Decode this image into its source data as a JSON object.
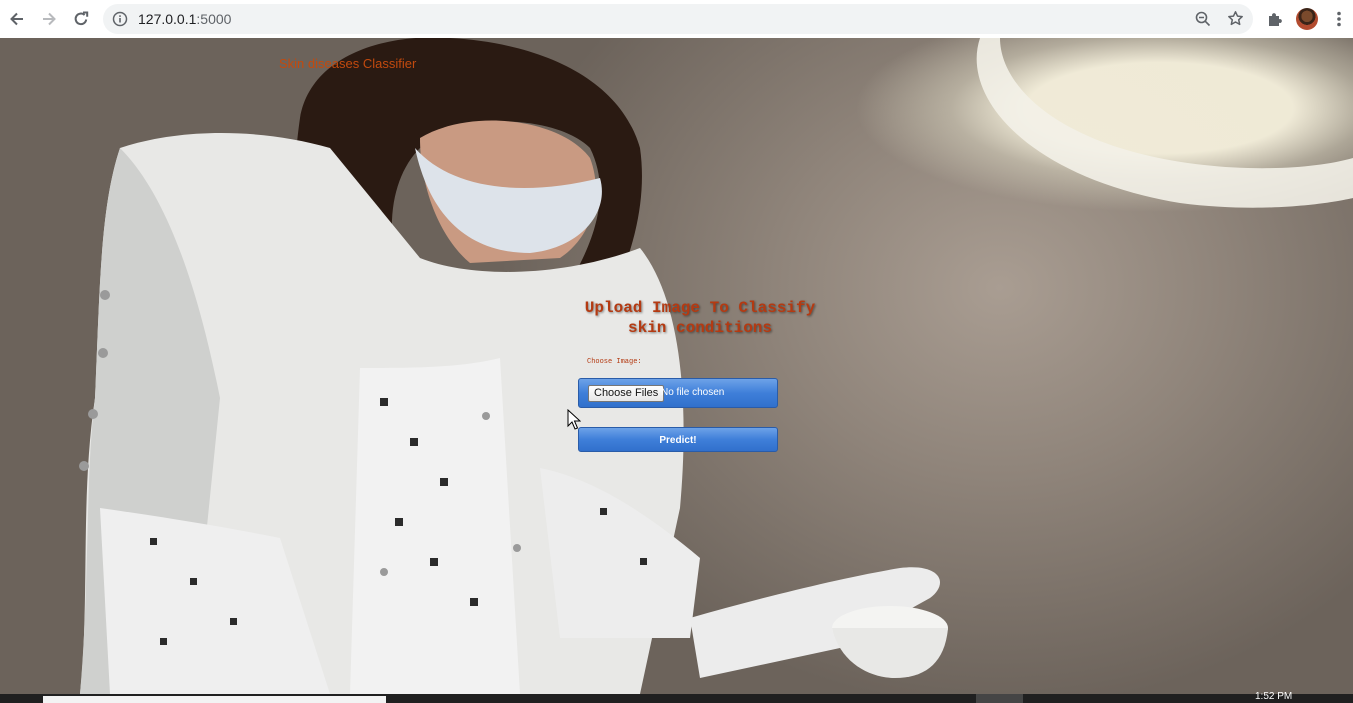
{
  "browser": {
    "url_host": "127.0.0.1",
    "url_port": ":5000",
    "icons": [
      "back-arrow-icon",
      "forward-arrow-icon",
      "reload-icon",
      "info-icon",
      "zoom-icon",
      "star-icon",
      "extensions-icon",
      "more-icon"
    ]
  },
  "page": {
    "brand": "Skin diseases Classifier",
    "upload_title_line1": "Upload Image To Classify",
    "upload_title_line2": "skin conditions",
    "choose_label": "Choose Image:",
    "file_button": "Choose Files",
    "file_status": "No file chosen",
    "predict_label": "Predict!"
  },
  "taskbar": {
    "clock": "1:52 PM"
  },
  "colors": {
    "accent_text": "#b43a12",
    "button_blue": "#3f7fd9"
  }
}
